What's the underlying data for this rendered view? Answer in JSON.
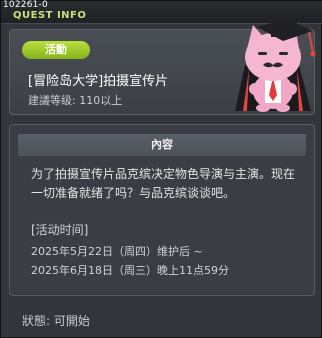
{
  "window": {
    "id": "102261-0",
    "title": "QUEST INFO"
  },
  "header": {
    "badge": "活動",
    "quest_title": "[冒险岛大学]拍摄宣传片",
    "level_requirement": "建議等级: 110以上"
  },
  "content": {
    "section_title": "內容",
    "description_line1": "为了拍摄宣传片品克缤决定物色导演与主演。现在",
    "description_line2": "一切准备就绪了吗？与品克缤谈谈吧。",
    "activity_time_label": "[活动时间]",
    "start_date": "2025年5月22日（周四）维护后 ~",
    "end_date": "2025年6月18日（周三）晚上11点59分"
  },
  "status": "狀態: 可開始",
  "colors": {
    "accent": "#a8d22f",
    "title_green": "#c8e27a"
  }
}
